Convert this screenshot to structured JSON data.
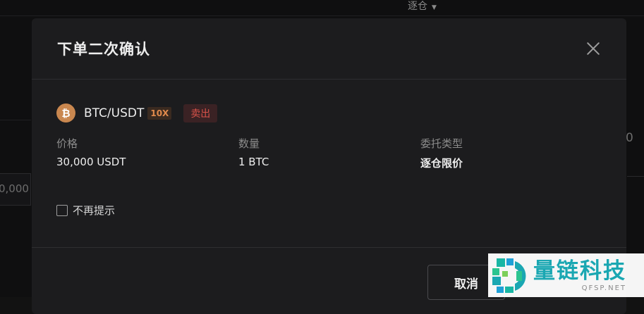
{
  "background": {
    "top_label": "逐仓",
    "left_partial_value": "0,000",
    "right_partial_value": "0"
  },
  "modal": {
    "title": "下单二次确认",
    "pair": {
      "coin_symbol": "₿",
      "name": "BTC/USDT",
      "leverage": "10X",
      "side": "卖出"
    },
    "info": [
      {
        "label": "价格",
        "value": "30,000 USDT"
      },
      {
        "label": "数量",
        "value": "1 BTC"
      },
      {
        "label": "委托类型",
        "value": "逐仓限价"
      }
    ],
    "dont_show_label": "不再提示",
    "cancel_label": "取消"
  },
  "watermark": {
    "text": "量链科技",
    "sub": "QFSP.NET"
  },
  "colors": {
    "accent_orange": "#e08a4c",
    "sell_red": "#d9534a",
    "coin_bitcoin": "#c9874f",
    "watermark_teal": "#1aa7b2"
  }
}
